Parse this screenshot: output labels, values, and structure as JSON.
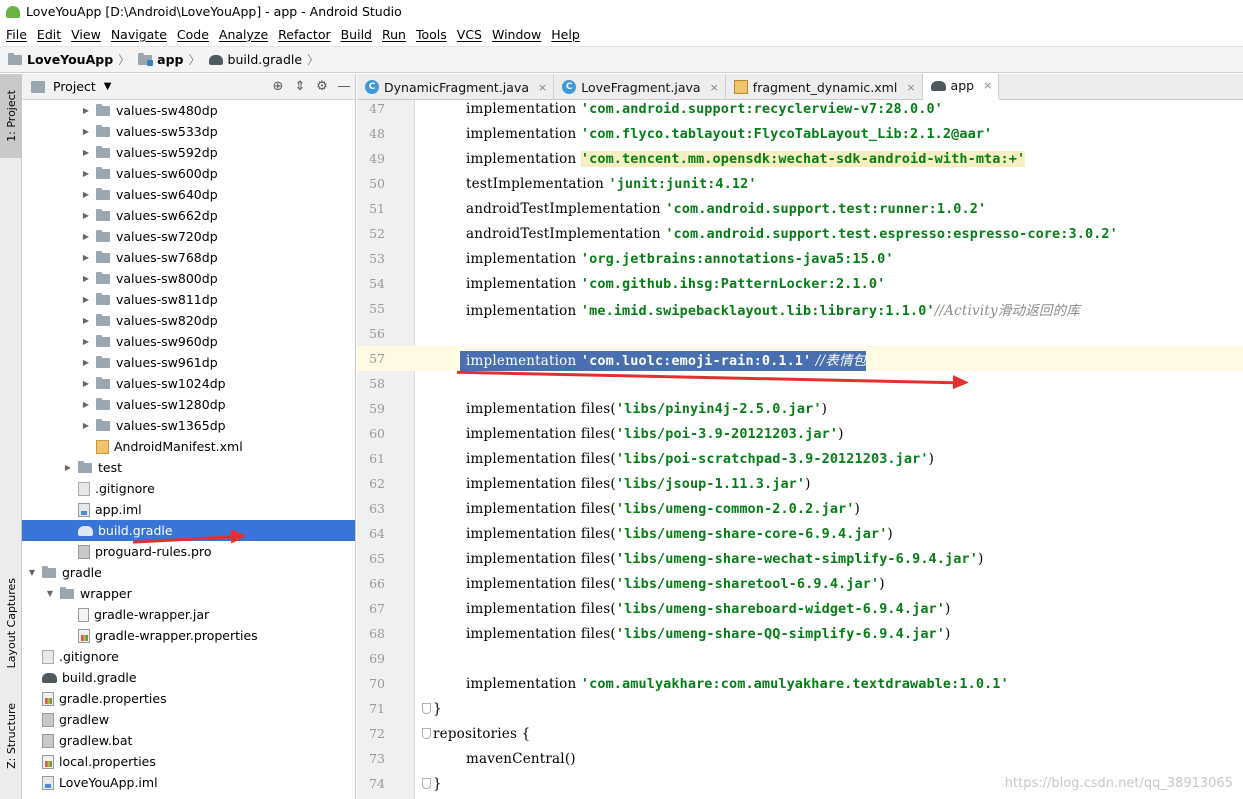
{
  "window": {
    "title": "LoveYouApp [D:\\Android\\LoveYouApp] - app - Android Studio"
  },
  "menu": [
    "File",
    "Edit",
    "View",
    "Navigate",
    "Code",
    "Analyze",
    "Refactor",
    "Build",
    "Run",
    "Tools",
    "VCS",
    "Window",
    "Help"
  ],
  "breadcrumb": {
    "project": "LoveYouApp",
    "module": "app",
    "file": "build.gradle"
  },
  "left_strip": {
    "project_tab": "1: Project",
    "layout_tab": "Layout Captures",
    "structure_tab": "Z: Structure"
  },
  "project_panel": {
    "title": "Project",
    "tree": [
      {
        "label": "values-sw480dp",
        "kind": "folder",
        "depth": 3,
        "expandable": true
      },
      {
        "label": "values-sw533dp",
        "kind": "folder",
        "depth": 3,
        "expandable": true
      },
      {
        "label": "values-sw592dp",
        "kind": "folder",
        "depth": 3,
        "expandable": true
      },
      {
        "label": "values-sw600dp",
        "kind": "folder",
        "depth": 3,
        "expandable": true
      },
      {
        "label": "values-sw640dp",
        "kind": "folder",
        "depth": 3,
        "expandable": true
      },
      {
        "label": "values-sw662dp",
        "kind": "folder",
        "depth": 3,
        "expandable": true
      },
      {
        "label": "values-sw720dp",
        "kind": "folder",
        "depth": 3,
        "expandable": true
      },
      {
        "label": "values-sw768dp",
        "kind": "folder",
        "depth": 3,
        "expandable": true
      },
      {
        "label": "values-sw800dp",
        "kind": "folder",
        "depth": 3,
        "expandable": true
      },
      {
        "label": "values-sw811dp",
        "kind": "folder",
        "depth": 3,
        "expandable": true
      },
      {
        "label": "values-sw820dp",
        "kind": "folder",
        "depth": 3,
        "expandable": true
      },
      {
        "label": "values-sw960dp",
        "kind": "folder",
        "depth": 3,
        "expandable": true
      },
      {
        "label": "values-sw961dp",
        "kind": "folder",
        "depth": 3,
        "expandable": true
      },
      {
        "label": "values-sw1024dp",
        "kind": "folder",
        "depth": 3,
        "expandable": true
      },
      {
        "label": "values-sw1280dp",
        "kind": "folder",
        "depth": 3,
        "expandable": true
      },
      {
        "label": "values-sw1365dp",
        "kind": "folder",
        "depth": 3,
        "expandable": true
      },
      {
        "label": "AndroidManifest.xml",
        "kind": "xml",
        "depth": 3,
        "expandable": false
      },
      {
        "label": "test",
        "kind": "folder",
        "depth": 2,
        "expandable": true
      },
      {
        "label": ".gitignore",
        "kind": "git",
        "depth": 2,
        "expandable": false
      },
      {
        "label": "app.iml",
        "kind": "iml",
        "depth": 2,
        "expandable": false
      },
      {
        "label": "build.gradle",
        "kind": "gradle",
        "depth": 2,
        "expandable": false,
        "selected": true
      },
      {
        "label": "proguard-rules.pro",
        "kind": "file",
        "depth": 2,
        "expandable": false
      },
      {
        "label": "gradle",
        "kind": "folder",
        "depth": 0,
        "expandable": true,
        "expanded": true
      },
      {
        "label": "wrapper",
        "kind": "folder",
        "depth": 1,
        "expandable": true,
        "expanded": true
      },
      {
        "label": "gradle-wrapper.jar",
        "kind": "jar",
        "depth": 2,
        "expandable": false
      },
      {
        "label": "gradle-wrapper.properties",
        "kind": "props",
        "depth": 2,
        "expandable": false
      },
      {
        "label": ".gitignore",
        "kind": "git",
        "depth": 0,
        "expandable": false
      },
      {
        "label": "build.gradle",
        "kind": "gradle",
        "depth": 0,
        "expandable": false
      },
      {
        "label": "gradle.properties",
        "kind": "props",
        "depth": 0,
        "expandable": false
      },
      {
        "label": "gradlew",
        "kind": "file",
        "depth": 0,
        "expandable": false
      },
      {
        "label": "gradlew.bat",
        "kind": "file",
        "depth": 0,
        "expandable": false
      },
      {
        "label": "local.properties",
        "kind": "props",
        "depth": 0,
        "expandable": false
      },
      {
        "label": "LoveYouApp.iml",
        "kind": "iml",
        "depth": 0,
        "expandable": false
      }
    ]
  },
  "tabs": [
    {
      "label": "DynamicFragment.java",
      "icon": "class-icon"
    },
    {
      "label": "LoveFragment.java",
      "icon": "class-icon"
    },
    {
      "label": "fragment_dynamic.xml",
      "icon": "xml-icon"
    },
    {
      "label": "app",
      "icon": "gradle-icon",
      "active": true
    }
  ],
  "editor": {
    "lines": [
      {
        "n": "47",
        "kw": "implementation ",
        "str": "'com.android.support:recyclerview-v7:28.0.0'",
        "cmt": ""
      },
      {
        "n": "48",
        "kw": "implementation ",
        "str": "'com.flyco.tablayout:FlycoTabLayout_Lib:2.1.2@aar'",
        "cmt": ""
      },
      {
        "n": "49",
        "kw": "implementation ",
        "str": "'com.tencent.mm.opensdk:wechat-sdk-android-with-mta:+'",
        "cmt": "",
        "highlight": "yellow"
      },
      {
        "n": "50",
        "kw": "testImplementation ",
        "str": "'junit:junit:4.12'",
        "cmt": ""
      },
      {
        "n": "51",
        "kw": "androidTestImplementation ",
        "str": "'com.android.support.test:runner:1.0.2'",
        "cmt": ""
      },
      {
        "n": "52",
        "kw": "androidTestImplementation ",
        "str": "'com.android.support.test.espresso:espresso-core:3.0.2'",
        "cmt": ""
      },
      {
        "n": "53",
        "kw": "implementation ",
        "str": "'org.jetbrains:annotations-java5:15.0'",
        "cmt": ""
      },
      {
        "n": "54",
        "kw": "implementation ",
        "str": "'com.github.ihsg:PatternLocker:2.1.0'",
        "cmt": ""
      },
      {
        "n": "55",
        "kw": "implementation ",
        "str": "'me.imid.swipebacklayout.lib:library:1.1.0'",
        "cmt": "//Activity滑动返回的库"
      },
      {
        "n": "56",
        "kw": "",
        "str": "",
        "cmt": ""
      },
      {
        "n": "57",
        "kw": "implementation ",
        "str": "'com.luolc:emoji-rain:0.1.1'",
        "cmt": " //表情包",
        "selected": true
      },
      {
        "n": "58",
        "kw": "",
        "str": "",
        "cmt": ""
      },
      {
        "n": "59",
        "kw": "implementation files(",
        "str": "'libs/pinyin4j-2.5.0.jar'",
        "cmt": "",
        "tail": ")"
      },
      {
        "n": "60",
        "kw": "implementation files(",
        "str": "'libs/poi-3.9-20121203.jar'",
        "cmt": "",
        "tail": ")"
      },
      {
        "n": "61",
        "kw": "implementation files(",
        "str": "'libs/poi-scratchpad-3.9-20121203.jar'",
        "cmt": "",
        "tail": ")"
      },
      {
        "n": "62",
        "kw": "implementation files(",
        "str": "'libs/jsoup-1.11.3.jar'",
        "cmt": "",
        "tail": ")"
      },
      {
        "n": "63",
        "kw": "implementation files(",
        "str": "'libs/umeng-common-2.0.2.jar'",
        "cmt": "",
        "tail": ")"
      },
      {
        "n": "64",
        "kw": "implementation files(",
        "str": "'libs/umeng-share-core-6.9.4.jar'",
        "cmt": "",
        "tail": ")"
      },
      {
        "n": "65",
        "kw": "implementation files(",
        "str": "'libs/umeng-share-wechat-simplify-6.9.4.jar'",
        "cmt": "",
        "tail": ")"
      },
      {
        "n": "66",
        "kw": "implementation files(",
        "str": "'libs/umeng-sharetool-6.9.4.jar'",
        "cmt": "",
        "tail": ")"
      },
      {
        "n": "67",
        "kw": "implementation files(",
        "str": "'libs/umeng-shareboard-widget-6.9.4.jar'",
        "cmt": "",
        "tail": ")"
      },
      {
        "n": "68",
        "kw": "implementation files(",
        "str": "'libs/umeng-share-QQ-simplify-6.9.4.jar'",
        "cmt": "",
        "tail": ")"
      },
      {
        "n": "69",
        "kw": "",
        "str": "",
        "cmt": ""
      },
      {
        "n": "70",
        "kw": "implementation ",
        "str": "'com.amulyakhare:com.amulyakhare.textdrawable:1.0.1'",
        "cmt": ""
      },
      {
        "n": "71",
        "kw": "}",
        "str": "",
        "cmt": "",
        "outdent": true,
        "fold": true
      },
      {
        "n": "72",
        "kw": "repositories {",
        "str": "",
        "cmt": "",
        "outdent": true,
        "fold": true
      },
      {
        "n": "73",
        "kw": "mavenCentral()",
        "str": "",
        "cmt": ""
      },
      {
        "n": "74",
        "kw": "}",
        "str": "",
        "cmt": "",
        "outdent": true,
        "fold": true
      }
    ]
  },
  "watermark": "https://blog.csdn.net/qq_38913065",
  "colors": {
    "selection": "#3875d7",
    "string": "#067d17",
    "annotation_arrow": "#e03030"
  }
}
